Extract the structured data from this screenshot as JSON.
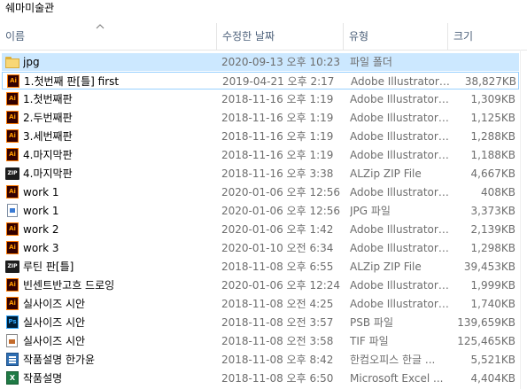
{
  "folder_title": "쉐마미술관",
  "columns": {
    "name": "이름",
    "date": "수정한 날짜",
    "type": "유형",
    "size": "크기"
  },
  "files": [
    {
      "name": "jpg",
      "date": "2020-09-13 오후 10:23",
      "type": "파일 폴더",
      "size": "",
      "icon": "folder-icon",
      "selected": true
    },
    {
      "name": "1.첫번째 판[틀] first",
      "date": "2019-04-21 오후 2:17",
      "type": "Adobe Illustrator ...",
      "size": "38,827KB",
      "icon": "illustrator-icon",
      "focused": true
    },
    {
      "name": "1.첫번째판",
      "date": "2018-11-16 오후 1:19",
      "type": "Adobe Illustrator ...",
      "size": "1,309KB",
      "icon": "illustrator-icon"
    },
    {
      "name": "2.두번째판",
      "date": "2018-11-16 오후 1:19",
      "type": "Adobe Illustrator ...",
      "size": "1,125KB",
      "icon": "illustrator-icon"
    },
    {
      "name": "3.세번째판",
      "date": "2018-11-16 오후 1:19",
      "type": "Adobe Illustrator ...",
      "size": "1,288KB",
      "icon": "illustrator-icon"
    },
    {
      "name": "4.마지막판",
      "date": "2018-11-16 오후 1:19",
      "type": "Adobe Illustrator ...",
      "size": "1,188KB",
      "icon": "illustrator-icon"
    },
    {
      "name": "4.마지막판",
      "date": "2018-11-16 오후 3:38",
      "type": "ALZip ZIP File",
      "size": "4,667KB",
      "icon": "zip-icon"
    },
    {
      "name": "work 1",
      "date": "2020-01-06 오후 12:56",
      "type": "Adobe Illustrator ...",
      "size": "408KB",
      "icon": "illustrator-icon"
    },
    {
      "name": "work 1",
      "date": "2020-01-06 오후 12:56",
      "type": "JPG 파일",
      "size": "3,373KB",
      "icon": "jpg-icon"
    },
    {
      "name": "work 2",
      "date": "2020-01-06 오후 1:42",
      "type": "Adobe Illustrator ...",
      "size": "2,139KB",
      "icon": "illustrator-icon"
    },
    {
      "name": "work 3",
      "date": "2020-01-10 오전 6:34",
      "type": "Adobe Illustrator ...",
      "size": "1,298KB",
      "icon": "illustrator-icon"
    },
    {
      "name": "루틴 판[틀]",
      "date": "2018-11-08 오후 6:55",
      "type": "ALZip ZIP File",
      "size": "39,453KB",
      "icon": "zip-icon"
    },
    {
      "name": "빈센트반고흐 드로잉",
      "date": "2020-01-06 오후 12:24",
      "type": "Adobe Illustrator ...",
      "size": "1,999KB",
      "icon": "illustrator-icon"
    },
    {
      "name": "실사이즈 시안",
      "date": "2018-11-08 오전 4:25",
      "type": "Adobe Illustrator ...",
      "size": "1,740KB",
      "icon": "illustrator-icon"
    },
    {
      "name": "실사이즈 시안",
      "date": "2018-11-08 오전 3:57",
      "type": "PSB 파일",
      "size": "139,659KB",
      "icon": "photoshop-icon"
    },
    {
      "name": "실사이즈 시안",
      "date": "2018-11-08 오전 3:58",
      "type": "TIF 파일",
      "size": "125,465KB",
      "icon": "tif-icon"
    },
    {
      "name": "작품설명 한가윤",
      "date": "2018-11-08 오후 8:42",
      "type": "한컴오피스 한글 ...",
      "size": "5,521KB",
      "icon": "hwp-icon"
    },
    {
      "name": "작품설명",
      "date": "2018-11-08 오후 6:50",
      "type": "Microsoft Excel ...",
      "size": "4,404KB",
      "icon": "excel-icon"
    }
  ]
}
